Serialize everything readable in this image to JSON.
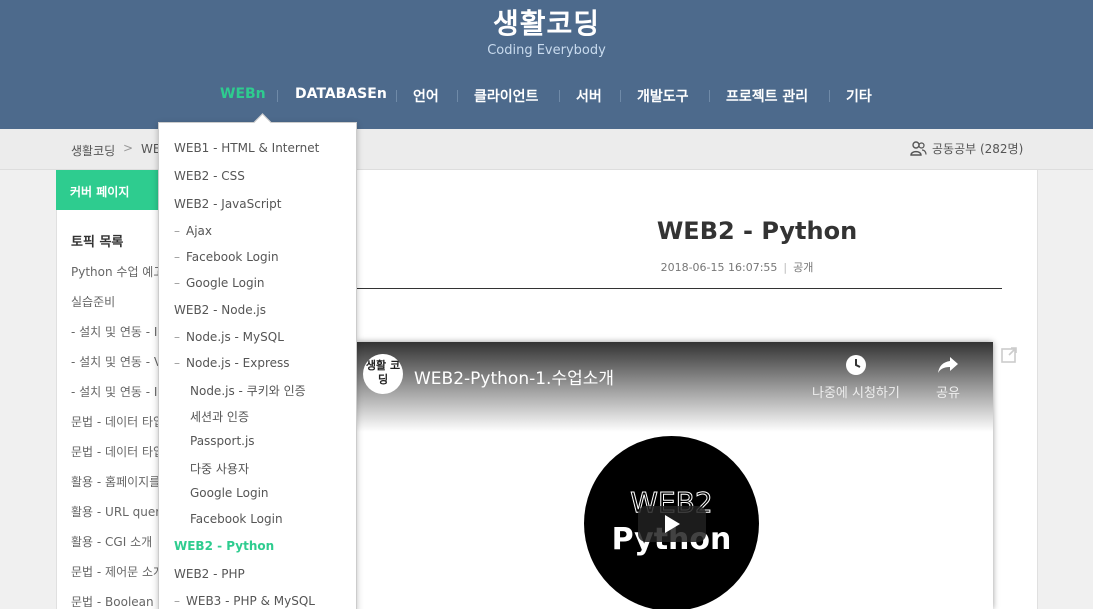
{
  "header": {
    "title": "생활코딩",
    "subtitle": "Coding Everybody",
    "nav": [
      {
        "label": "WEBn",
        "active": true
      },
      {
        "label": "DATABASEn"
      },
      {
        "label": "언어"
      },
      {
        "label": "클라이언트"
      },
      {
        "label": "서버"
      },
      {
        "label": "개발도구"
      },
      {
        "label": "프로젝트 관리"
      },
      {
        "label": "기타"
      }
    ]
  },
  "breadcrumb": {
    "home": "생활코딩",
    "separator": ">",
    "current": "WEB"
  },
  "study": {
    "label": "공동공부 (282명)",
    "icon": "users-icon"
  },
  "sidebar": {
    "cover": "커버 페이지",
    "topics_title": "토픽 목록",
    "items": [
      "Python 수업 예고",
      "실습준비",
      "- 설치 및 연동 - I",
      "- 설치 및 연동 - V",
      "- 설치 및 연동 - I",
      "문법 - 데이터 타입",
      "문법 - 데이터 타입",
      "활용 - 홈페이지를",
      "활용 - URL query",
      "활용 - CGI 소개",
      "문법 - 제어문 소개",
      "문법 - Boolean"
    ]
  },
  "post": {
    "title": "WEB2 - Python",
    "date": "2018-06-15 16:07:55",
    "visibility": "공개"
  },
  "video": {
    "title": "WEB2-Python-1.수업소개",
    "channel_logo_text": "생활 코딩",
    "watch_later": "나중에 시청하기",
    "share": "공유",
    "thumb_line1": "WEB2",
    "thumb_line2": "Python"
  },
  "dropdown": {
    "items": [
      {
        "label": "WEB1 - HTML & Internet",
        "indent": false
      },
      {
        "label": "WEB2 - CSS",
        "indent": false
      },
      {
        "label": "WEB2 - JavaScript",
        "indent": false
      },
      {
        "label": "Ajax",
        "indent": true,
        "dash": true
      },
      {
        "label": "Facebook Login",
        "indent": true,
        "dash": true
      },
      {
        "label": "Google Login",
        "indent": true,
        "dash": true
      },
      {
        "label": "WEB2 - Node.js",
        "indent": false
      },
      {
        "label": "Node.js - MySQL",
        "indent": true,
        "dash": true
      },
      {
        "label": "Node.js - Express",
        "indent": true,
        "dash": true
      },
      {
        "label": "Node.js - 쿠키와 인증",
        "indent": true,
        "dash": false
      },
      {
        "label": "세션과 인증",
        "indent": true,
        "dash": false
      },
      {
        "label": "Passport.js",
        "indent": true,
        "dash": false
      },
      {
        "label": "다중 사용자",
        "indent": true,
        "dash": false
      },
      {
        "label": "Google Login",
        "indent": true,
        "dash": false
      },
      {
        "label": "Facebook Login",
        "indent": true,
        "dash": false
      },
      {
        "label": "WEB2 - Python",
        "indent": false,
        "active": true
      },
      {
        "label": "WEB2 - PHP",
        "indent": false
      },
      {
        "label": "WEB3 - PHP & MySQL",
        "indent": true,
        "dash": true
      }
    ]
  },
  "colors": {
    "header_bg": "#4d6a8c",
    "accent": "#2ecc8f"
  }
}
